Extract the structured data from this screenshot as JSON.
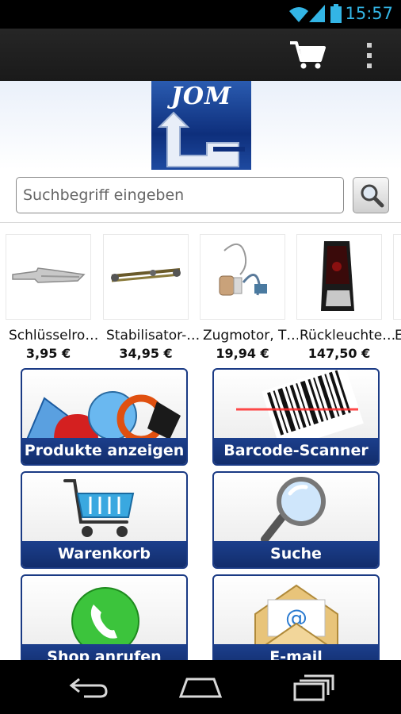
{
  "status_bar": {
    "time": "15:57",
    "icons": [
      "wifi-icon",
      "signal-icon",
      "battery-icon"
    ]
  },
  "action_bar": {
    "icons": [
      "cart-icon",
      "overflow-menu-icon"
    ]
  },
  "logo": {
    "text": "JOM"
  },
  "search": {
    "placeholder": "Suchbegriff eingeben",
    "value": "",
    "button_icon": "magnifier-icon"
  },
  "products": [
    {
      "name": "Schlüsselro…",
      "price": "3,95 €",
      "image": "key-blank"
    },
    {
      "name": "Stabilisator-…",
      "price": "34,95 €",
      "image": "stabilizer-link"
    },
    {
      "name": "Zugmotor, T…",
      "price": "19,94 €",
      "image": "actuator-motor"
    },
    {
      "name": "Rückleuchte…",
      "price": "147,50 €",
      "image": "tail-light"
    },
    {
      "name": "E",
      "price": "",
      "image": ""
    }
  ],
  "tiles": [
    {
      "label": "Produkte anzeigen",
      "icon": "products-icon"
    },
    {
      "label": "Barcode-Scanner",
      "icon": "barcode-icon"
    },
    {
      "label": "Warenkorb",
      "icon": "shopping-cart-icon"
    },
    {
      "label": "Suche",
      "icon": "magnifier-icon"
    },
    {
      "label": "Shop anrufen",
      "icon": "phone-icon"
    },
    {
      "label": "E-mail",
      "icon": "mail-icon"
    }
  ],
  "colors": {
    "accent_blue": "#1a3a84",
    "clock": "#33b5e5",
    "bar": "#1a1a1a"
  }
}
